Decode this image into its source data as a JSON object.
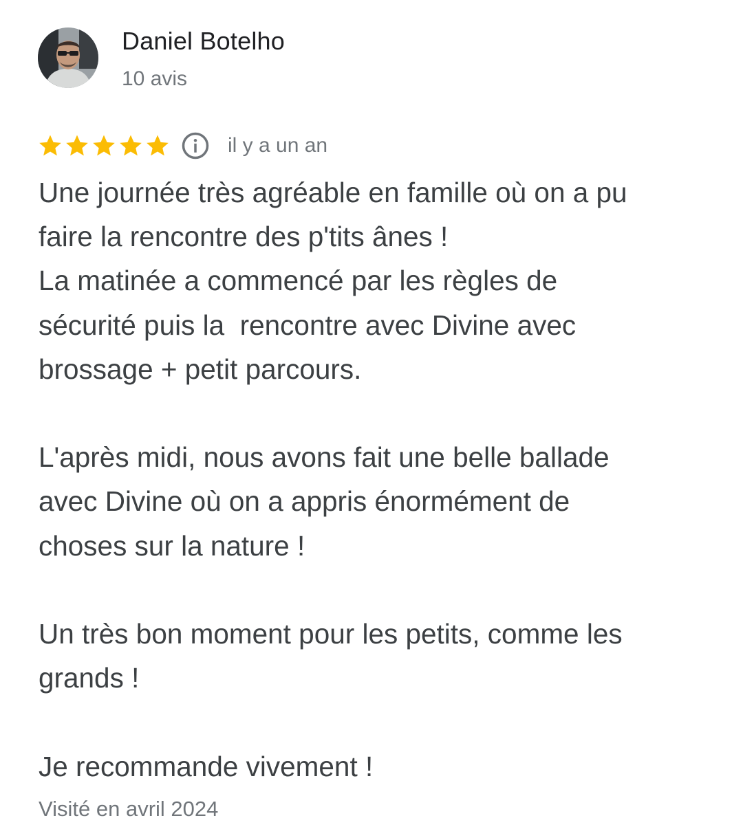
{
  "author": {
    "name": "Daniel Botelho",
    "meta": "10 avis",
    "avatar_icon": "user-photo"
  },
  "rating": {
    "stars": 5,
    "max_stars": 5,
    "star_color": "#fbbc04",
    "star_icon": "star-icon",
    "info_icon": "info-icon",
    "relative_date": "il y a un an"
  },
  "review": {
    "text": "Une journée très agréable en famille où on a pu\nfaire la rencontre des p'tits ânes !\nLa matinée a commencé par les règles de\nsécurité puis la  rencontre avec Divine avec\nbrossage + petit parcours.\n\nL'après midi, nous avons fait une belle ballade\navec Divine où on a appris énormément de\nchoses sur la nature !\n\nUn très bon moment pour les petits, comme les\ngrands !\n\nJe recommande vivement !",
    "visit": "Visité en avril 2024"
  },
  "colors": {
    "text_primary": "#202124",
    "text_body": "#3c4043",
    "text_secondary": "#70757a"
  }
}
